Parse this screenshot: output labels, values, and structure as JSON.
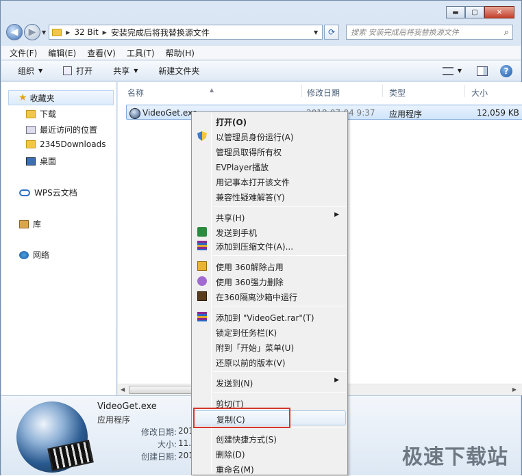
{
  "window": {
    "caption": {
      "minimize": "▬",
      "maximize": "▢",
      "close": "✕"
    }
  },
  "address": {
    "crumbs": [
      "32 Bit",
      "安装完成后将我替换源文件"
    ],
    "search_placeholder": "搜索 安装完成后将我替换源文件"
  },
  "menubar": [
    "文件(F)",
    "编辑(E)",
    "查看(V)",
    "工具(T)",
    "帮助(H)"
  ],
  "toolbar": {
    "organize": "组织",
    "open": "打开",
    "share": "共享",
    "new_folder": "新建文件夹"
  },
  "navpane": {
    "favorites": "收藏夹",
    "items": [
      "下载",
      "最近访问的位置",
      "2345Downloads",
      "桌面"
    ],
    "wps": "WPS云文档",
    "library": "库",
    "network": "网络"
  },
  "columns": {
    "name": "名称",
    "modified": "修改日期",
    "type": "类型",
    "size": "大小"
  },
  "file": {
    "name": "VideoGet.exe",
    "modified": "2018-07-04 9:37",
    "type": "应用程序",
    "size": "12,059 KB"
  },
  "details": {
    "name": "VideoGet.exe",
    "type": "应用程序",
    "modified_label": "修改日期:",
    "modified_value": "2018",
    "size_label": "大小:",
    "size_value": "11.7",
    "created_label": "创建日期:",
    "created_value": "2018"
  },
  "context_menu": {
    "open": "打开(O)",
    "run_admin": "以管理员身份运行(A)",
    "take_owner": "管理员取得所有权",
    "evplayer": "EVPlayer播放",
    "notepad": "用记事本打开该文件",
    "compat": "兼容性疑难解答(Y)",
    "share": "共享(H)",
    "send_phone": "发送到手机",
    "add_archive": "添加到压缩文件(A)...",
    "unlock360": "使用 360解除占用",
    "delete360": "使用 360强力删除",
    "sandbox360": "在360隔离沙箱中运行",
    "add_rar": "添加到 \"VideoGet.rar\"(T)",
    "pin_taskbar": "锁定到任务栏(K)",
    "pin_start": "附到「开始」菜单(U)",
    "restore": "还原以前的版本(V)",
    "send_to": "发送到(N)",
    "cut": "剪切(T)",
    "copy": "复制(C)",
    "shortcut": "创建快捷方式(S)",
    "delete": "删除(D)",
    "rename": "重命名(M)"
  },
  "watermark": "极速下载站",
  "colors": {
    "highlight_box": "#d4372c",
    "selection": "#cfe4fb"
  }
}
